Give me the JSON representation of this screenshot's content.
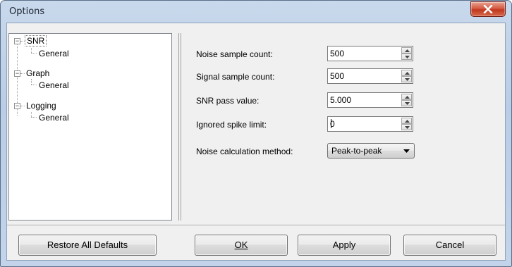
{
  "window": {
    "title": "Options"
  },
  "tree": {
    "nodes": [
      {
        "label": "SNR",
        "expanded": true,
        "children": [
          {
            "label": "General"
          }
        ]
      },
      {
        "label": "Graph",
        "expanded": true,
        "children": [
          {
            "label": "General"
          }
        ]
      },
      {
        "label": "Logging",
        "expanded": true,
        "children": [
          {
            "label": "General"
          }
        ]
      }
    ],
    "selected": "SNR"
  },
  "settings": {
    "noise_sample_count": {
      "label": "Noise sample count:",
      "value": "500"
    },
    "signal_sample_count": {
      "label": "Signal sample count:",
      "value": "500"
    },
    "snr_pass_value": {
      "label": "SNR pass value:",
      "value": "5.000"
    },
    "ignored_spike_limit": {
      "label": "Ignored spike limit:",
      "value": "0"
    },
    "noise_calculation_method": {
      "label": "Noise calculation method:",
      "value": "Peak-to-peak"
    }
  },
  "buttons": {
    "restore_defaults": "Restore All Defaults",
    "ok": "OK",
    "apply": "Apply",
    "cancel": "Cancel"
  },
  "icons": {
    "close": "close-x-icon",
    "spin_up": "triangle-up-icon",
    "spin_down": "triangle-down-icon",
    "dropdown": "triangle-down-icon",
    "tree_expander": "minus-box-icon"
  },
  "colors": {
    "close_button": "#c7432a",
    "window_frame": "#b9cde6",
    "dialog_background": "#f0f0f0"
  }
}
